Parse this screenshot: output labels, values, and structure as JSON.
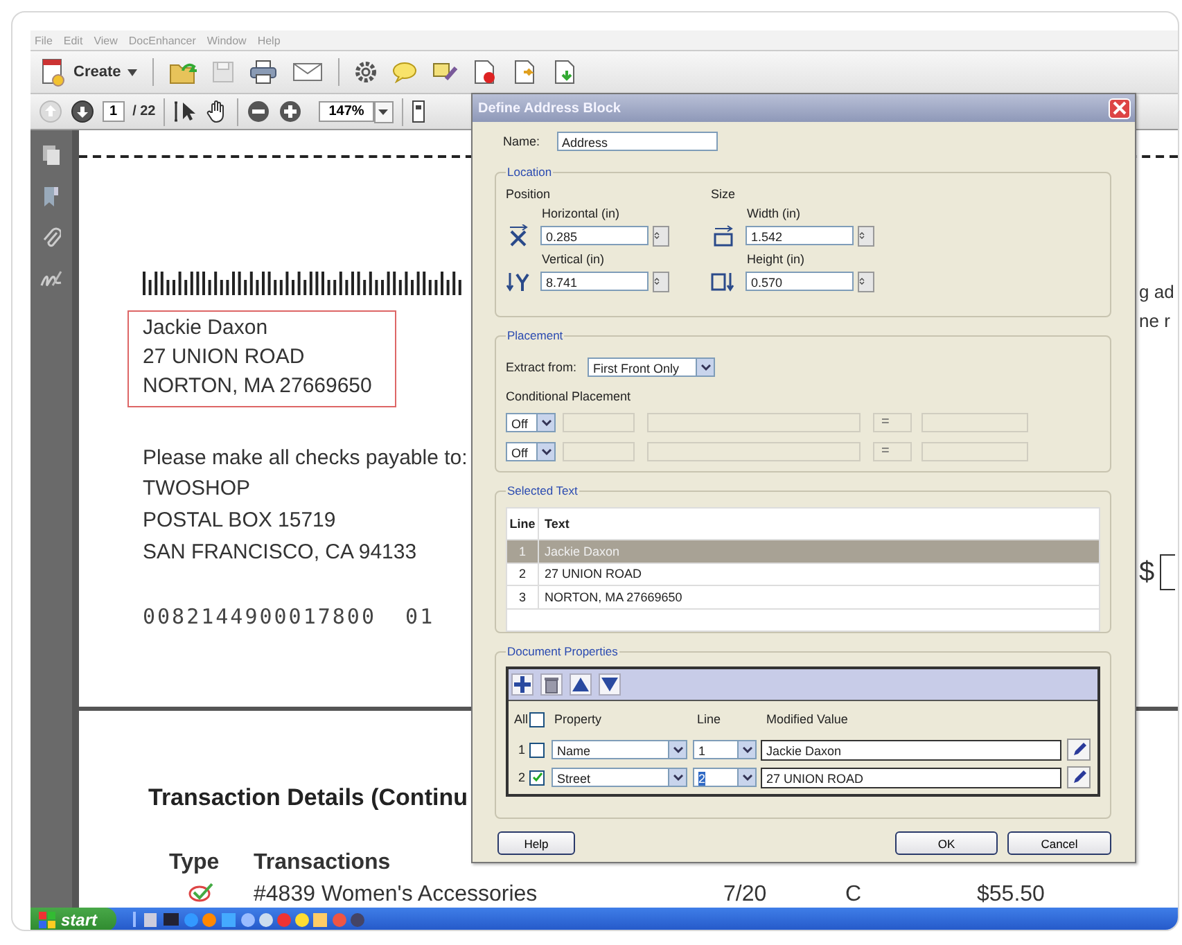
{
  "menu": [
    "File",
    "Edit",
    "View",
    "DocEnhancer",
    "Window",
    "Help"
  ],
  "toolbar": {
    "create_label": "Create"
  },
  "navigation": {
    "page": "1",
    "page_total": "/ 22",
    "zoom": "147%"
  },
  "document": {
    "address_lines": [
      "Jackie Daxon",
      "27 UNION ROAD",
      "NORTON, MA  27669650"
    ],
    "payable_label": "Please make all checks payable to:",
    "payee_lines": [
      "TWOSHOP",
      "POSTAL BOX 15719",
      "SAN FRANCISCO, CA  94133"
    ],
    "account_number": "0082144900017800  01",
    "cut_lines": [
      "g ad",
      "ne r"
    ],
    "amount_symbol": "$",
    "section_title": "Transaction Details (Continu",
    "columns": [
      "Type",
      "Transactions"
    ],
    "rows": [
      {
        "transaction": "#4839 Women's Accessories",
        "date": "7/20",
        "category": "C",
        "amount": "$55.50"
      }
    ]
  },
  "dialog": {
    "title": "Define Address Block",
    "name_label": "Name:",
    "name_value": "Address",
    "location": {
      "legend": "Location",
      "position_label": "Position",
      "size_label": "Size",
      "fields": [
        {
          "label": "Horizontal (in)",
          "value": "0.285"
        },
        {
          "label": "Width (in)",
          "value": "1.542"
        },
        {
          "label": "Vertical (in)",
          "value": "8.741"
        },
        {
          "label": "Height (in)",
          "value": "0.570"
        }
      ]
    },
    "placement": {
      "legend": "Placement",
      "extract_label": "Extract from:",
      "extract_value": "First Front Only",
      "conditional_label": "Conditional Placement",
      "conditions": [
        {
          "mode": "Off",
          "operator": "="
        },
        {
          "mode": "Off",
          "operator": "="
        }
      ]
    },
    "selected_text": {
      "legend": "Selected Text",
      "columns": [
        "Line",
        "Text"
      ],
      "rows": [
        {
          "line": "1",
          "text": "Jackie Daxon",
          "selected": true
        },
        {
          "line": "2",
          "text": "27 UNION ROAD",
          "selected": false
        },
        {
          "line": "3",
          "text": "NORTON, MA  27669650",
          "selected": false
        }
      ]
    },
    "document_properties": {
      "legend": "Document Properties",
      "all_label": "All",
      "all_checked": false,
      "columns": [
        "Property",
        "Line",
        "Modified Value"
      ],
      "rows": [
        {
          "number": "1",
          "checked": false,
          "property": "Name",
          "line": "1",
          "value": "Jackie Daxon"
        },
        {
          "number": "2",
          "checked": true,
          "property": "Street",
          "line": "2",
          "value": "27 UNION ROAD"
        }
      ]
    },
    "buttons": {
      "help": "Help",
      "ok": "OK",
      "cancel": "Cancel"
    }
  },
  "taskbar": {
    "start": "start"
  }
}
